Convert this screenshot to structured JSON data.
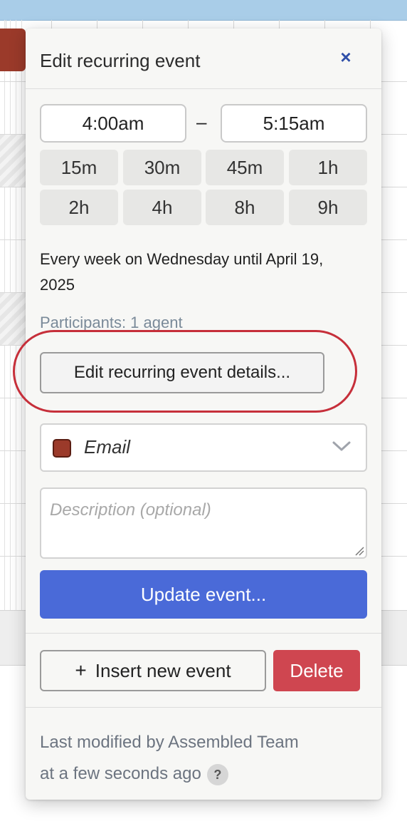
{
  "popover": {
    "title": "Edit recurring event",
    "close_icon": "×",
    "start_time": "4:00am",
    "time_separator": "–",
    "end_time": "5:15am",
    "durations": [
      "15m",
      "30m",
      "45m",
      "1h",
      "2h",
      "4h",
      "8h",
      "9h"
    ],
    "recurrence": "Every week on Wednesday until April 19, 2025",
    "participants": "Participants: 1 agent",
    "edit_details_label": "Edit recurring event details...",
    "category": {
      "label": "Email",
      "color": "#9b3a2a",
      "chevron_icon": "chevron-down-icon"
    },
    "description_placeholder": "Description (optional)",
    "update_label": "Update event...",
    "insert_label": "Insert new event",
    "insert_icon": "+",
    "delete_label": "Delete",
    "modified_line1": "Last modified by Assembled Team",
    "modified_line2": "at a few seconds ago",
    "help_icon": "?"
  },
  "colors": {
    "accent": "#4a6ad8",
    "danger": "#cf4650",
    "highlight": "#c62f3a"
  }
}
